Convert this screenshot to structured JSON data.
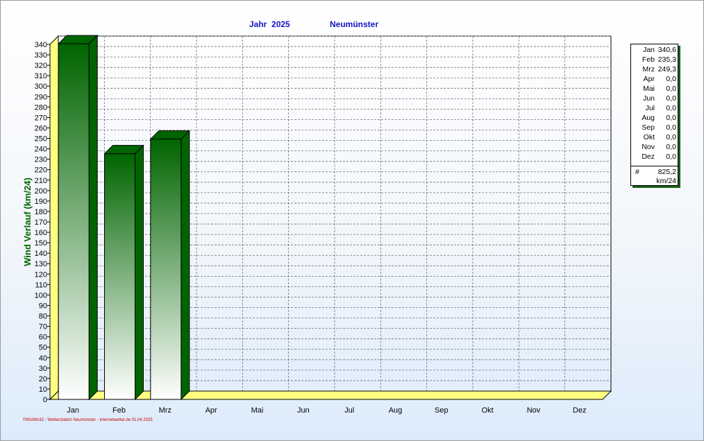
{
  "title": {
    "year": "Jahr  2025",
    "station": "Neumünster"
  },
  "chart_data": {
    "type": "bar",
    "categories": [
      "Jan",
      "Feb",
      "Mrz",
      "Apr",
      "Mai",
      "Jun",
      "Jul",
      "Aug",
      "Sep",
      "Okt",
      "Nov",
      "Dez"
    ],
    "values": [
      340.6,
      235.3,
      249.3,
      0,
      0,
      0,
      0,
      0,
      0,
      0,
      0,
      0
    ],
    "ylabel": "Wind Verlauf  (km/24)",
    "xlabel": "",
    "ylim": [
      0,
      340
    ],
    "ytick_step": 10,
    "grid": true,
    "legend_placement": "right"
  },
  "legend": {
    "rows": [
      {
        "month": "Jan",
        "value": "340,6"
      },
      {
        "month": "Feb",
        "value": "235,3"
      },
      {
        "month": "Mrz",
        "value": "249,3"
      },
      {
        "month": "Apr",
        "value": "0,0"
      },
      {
        "month": "Mai",
        "value": "0,0"
      },
      {
        "month": "Jun",
        "value": "0,0"
      },
      {
        "month": "Jul",
        "value": "0,0"
      },
      {
        "month": "Aug",
        "value": "0,0"
      },
      {
        "month": "Sep",
        "value": "0,0"
      },
      {
        "month": "Okt",
        "value": "0,0"
      },
      {
        "month": "Nov",
        "value": "0,0"
      },
      {
        "month": "Dez",
        "value": "0,0"
      }
    ],
    "total_symbol": "#",
    "total": "825,2",
    "unit": "km/24"
  },
  "footer": "©WsWin32 - Wetterstation Neumünster - Internetwetter.de 01.04.2025",
  "colors": {
    "title": "#1414c8",
    "ylabel": "#006400",
    "bar_dark": "#006400",
    "bar_light": "#ffffff",
    "floor": "#ffff80",
    "grid": "#707070",
    "footer": "#c80000"
  }
}
